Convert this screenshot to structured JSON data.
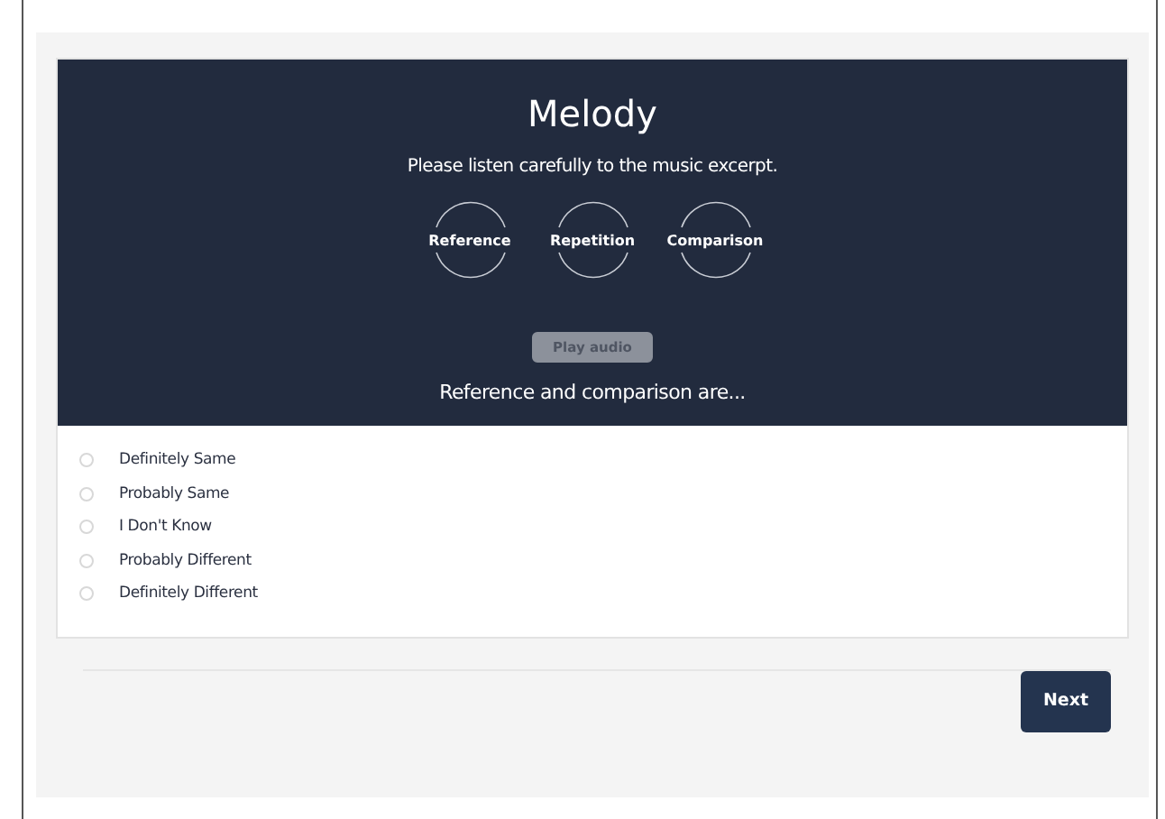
{
  "title": "Melody",
  "instruction": "Please listen carefully to the music excerpt.",
  "stimuli": [
    {
      "label": "Reference"
    },
    {
      "label": "Repetition"
    },
    {
      "label": "Comparison"
    }
  ],
  "play_button": {
    "label": "Play audio",
    "disabled": true
  },
  "question": "Reference and comparison are...",
  "options": [
    {
      "label": "Definitely Same",
      "selected": false
    },
    {
      "label": "Probably Same",
      "selected": false
    },
    {
      "label": "I Don't Know",
      "selected": false
    },
    {
      "label": "Probably Different",
      "selected": false
    },
    {
      "label": "Definitely Different",
      "selected": false
    }
  ],
  "next_button": {
    "label": "Next"
  }
}
